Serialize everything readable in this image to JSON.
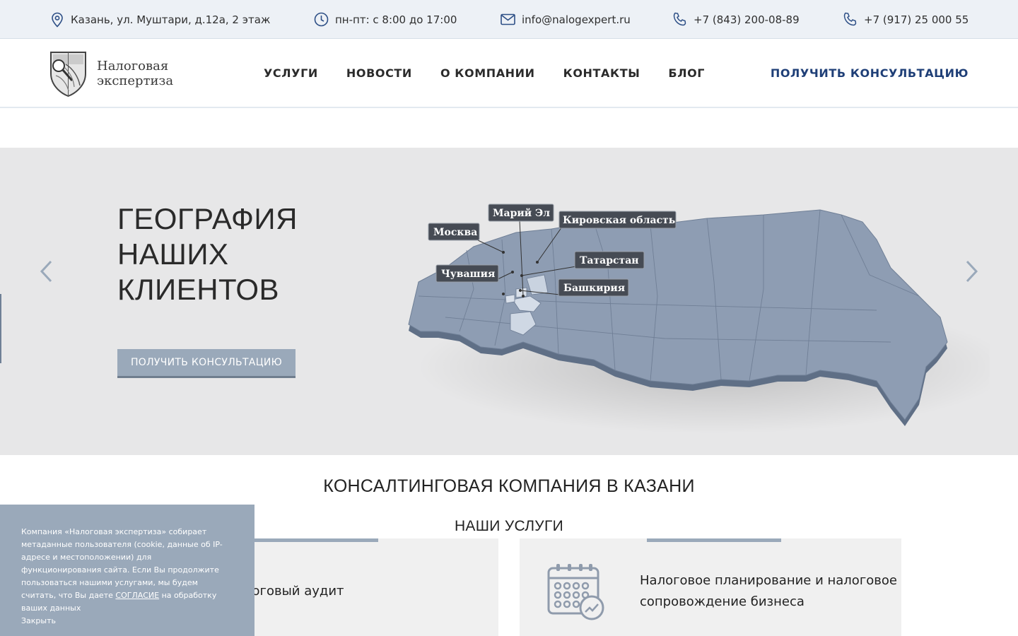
{
  "topbar": {
    "address": "Казань, ул. Муштари, д.12а, 2 этаж",
    "hours": "пн-пт: с 8:00 до 17:00",
    "email": "info@nalogexpert.ru",
    "phone1": "+7 (843) 200-08-89",
    "phone2": "+7 (917) 25 000 55",
    "icons": [
      "location-pin-icon",
      "clock-icon",
      "mail-icon",
      "phone-icon",
      "phone-icon"
    ]
  },
  "header": {
    "logo_line1": "Налоговая",
    "logo_line2": "экспертиза",
    "nav": [
      "УСЛУГИ",
      "НОВОСТИ",
      "О КОМПАНИИ",
      "КОНТАКТЫ",
      "БЛОГ"
    ],
    "cta": "ПОЛУЧИТЬ КОНСУЛЬТАЦИЮ"
  },
  "hero": {
    "title_line1": "ГЕОГРАФИЯ",
    "title_line2": "НАШИХ",
    "title_line3": "КЛИЕНТОВ",
    "button": "ПОЛУЧИТЬ КОНСУЛЬТАЦИЮ",
    "regions": [
      "Марий Эл",
      "Москва",
      "Кировская область",
      "Татарстан",
      "Чувашия",
      "Башкирия"
    ]
  },
  "main": {
    "company_title": "КОНСАЛТИНГОВАЯ КОМПАНИЯ В КАЗАНИ",
    "services_title": "НАШИ УСЛУГИ",
    "services": [
      {
        "label": "Налоговый аудит",
        "visible_label": "логовый аудит"
      },
      {
        "label_line1": "Налоговое планирование и налоговое",
        "label_line2": "сопровождение бизнеса"
      }
    ]
  },
  "cookie": {
    "text_before": "Компания «Налоговая экспертиза» собирает метаданные пользователя (cookie, данные об IP-адресе и местоположении) для функционирования сайта. Если Вы продолжите пользоваться нашими услугами, мы будем считать, что Вы даете",
    "link": "СОГЛАСИЕ",
    "text_after": "на обработку ваших данных",
    "close": "Закрыть"
  },
  "colors": {
    "accent": "#1f3f77",
    "button": "#9aa9ba",
    "topbar_bg": "#edf1f6",
    "hero_bg": "#e7e7e8",
    "icon": "#2d4f86"
  }
}
